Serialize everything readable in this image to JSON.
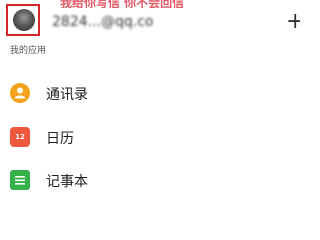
{
  "header": {
    "banner_text": "我给你写信 你不会回信",
    "account": "2824...@qq.co",
    "add_symbol": "+"
  },
  "section": {
    "title": "我的应用"
  },
  "apps": [
    {
      "label": "通讯录",
      "icon": "contacts-icon",
      "color": "#f4a21b"
    },
    {
      "label": "日历",
      "icon": "calendar-icon",
      "color": "#f0573f",
      "badge": "12"
    },
    {
      "label": "记事本",
      "icon": "notes-icon",
      "color": "#35b24a"
    }
  ],
  "colors": {
    "highlight_box": "#d8262d",
    "banner": "#e25a67"
  }
}
